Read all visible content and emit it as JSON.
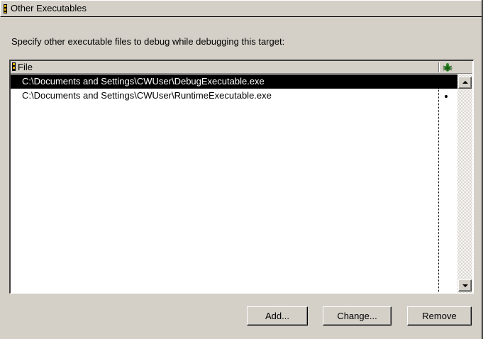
{
  "panel": {
    "title": "Other Executables",
    "instruction": "Specify other executable files to debug while debugging this target:"
  },
  "list": {
    "columns": {
      "file": "File",
      "debug_icon": "bug-icon"
    },
    "rows": [
      {
        "path": "C:\\Documents and Settings\\CWUser\\DebugExecutable.exe",
        "selected": true,
        "debug": false
      },
      {
        "path": "C:\\Documents and Settings\\CWUser\\RuntimeExecutable.exe",
        "selected": false,
        "debug": true
      }
    ]
  },
  "buttons": {
    "add": "Add...",
    "change": "Change...",
    "remove": "Remove"
  },
  "colors": {
    "face": "#d4d0c8",
    "selection": "#000000",
    "bug": "#2e8b22"
  }
}
